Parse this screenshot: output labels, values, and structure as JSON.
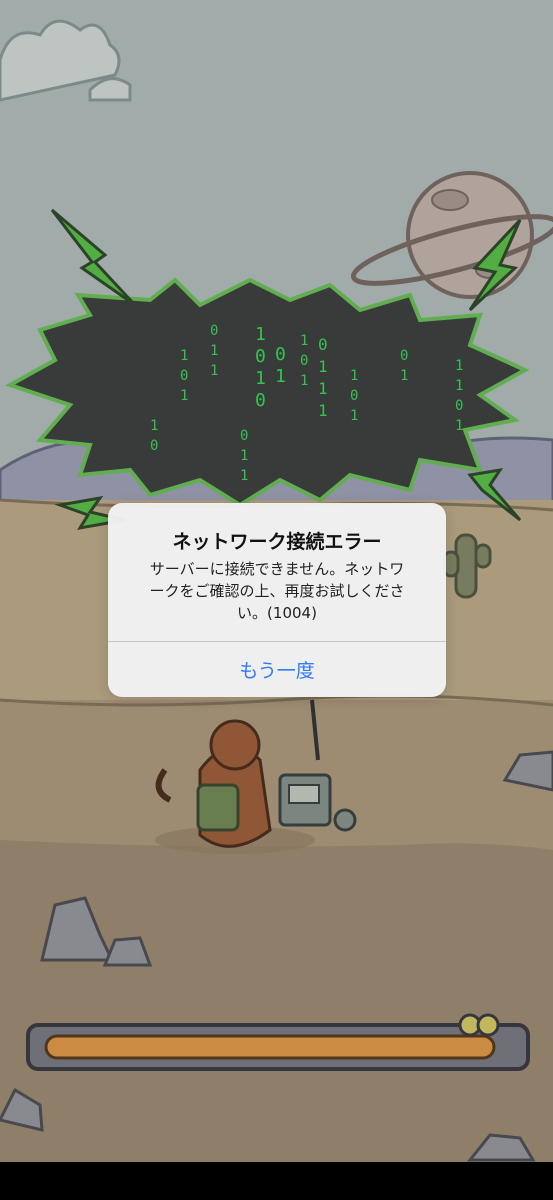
{
  "alert": {
    "title": "ネットワーク接続エラー",
    "message": "サーバーに接続できません。ネットワークをご確認の上、再度お試しください。(1004)",
    "retry_label": "もう一度"
  },
  "scene": {
    "icons": [
      "cloud-icon",
      "planet-icon",
      "lightning-icon",
      "cactus-icon",
      "rock-icon",
      "monkey-character-icon",
      "radio-machine-icon"
    ],
    "colors": {
      "sky": "#bcc9c7",
      "desert": "#c9b48f",
      "ground_dark": "#a69377",
      "lightning": "#5ccc4a",
      "matrix_green": "#39e35a",
      "alert_button": "#2f7cf6"
    }
  }
}
